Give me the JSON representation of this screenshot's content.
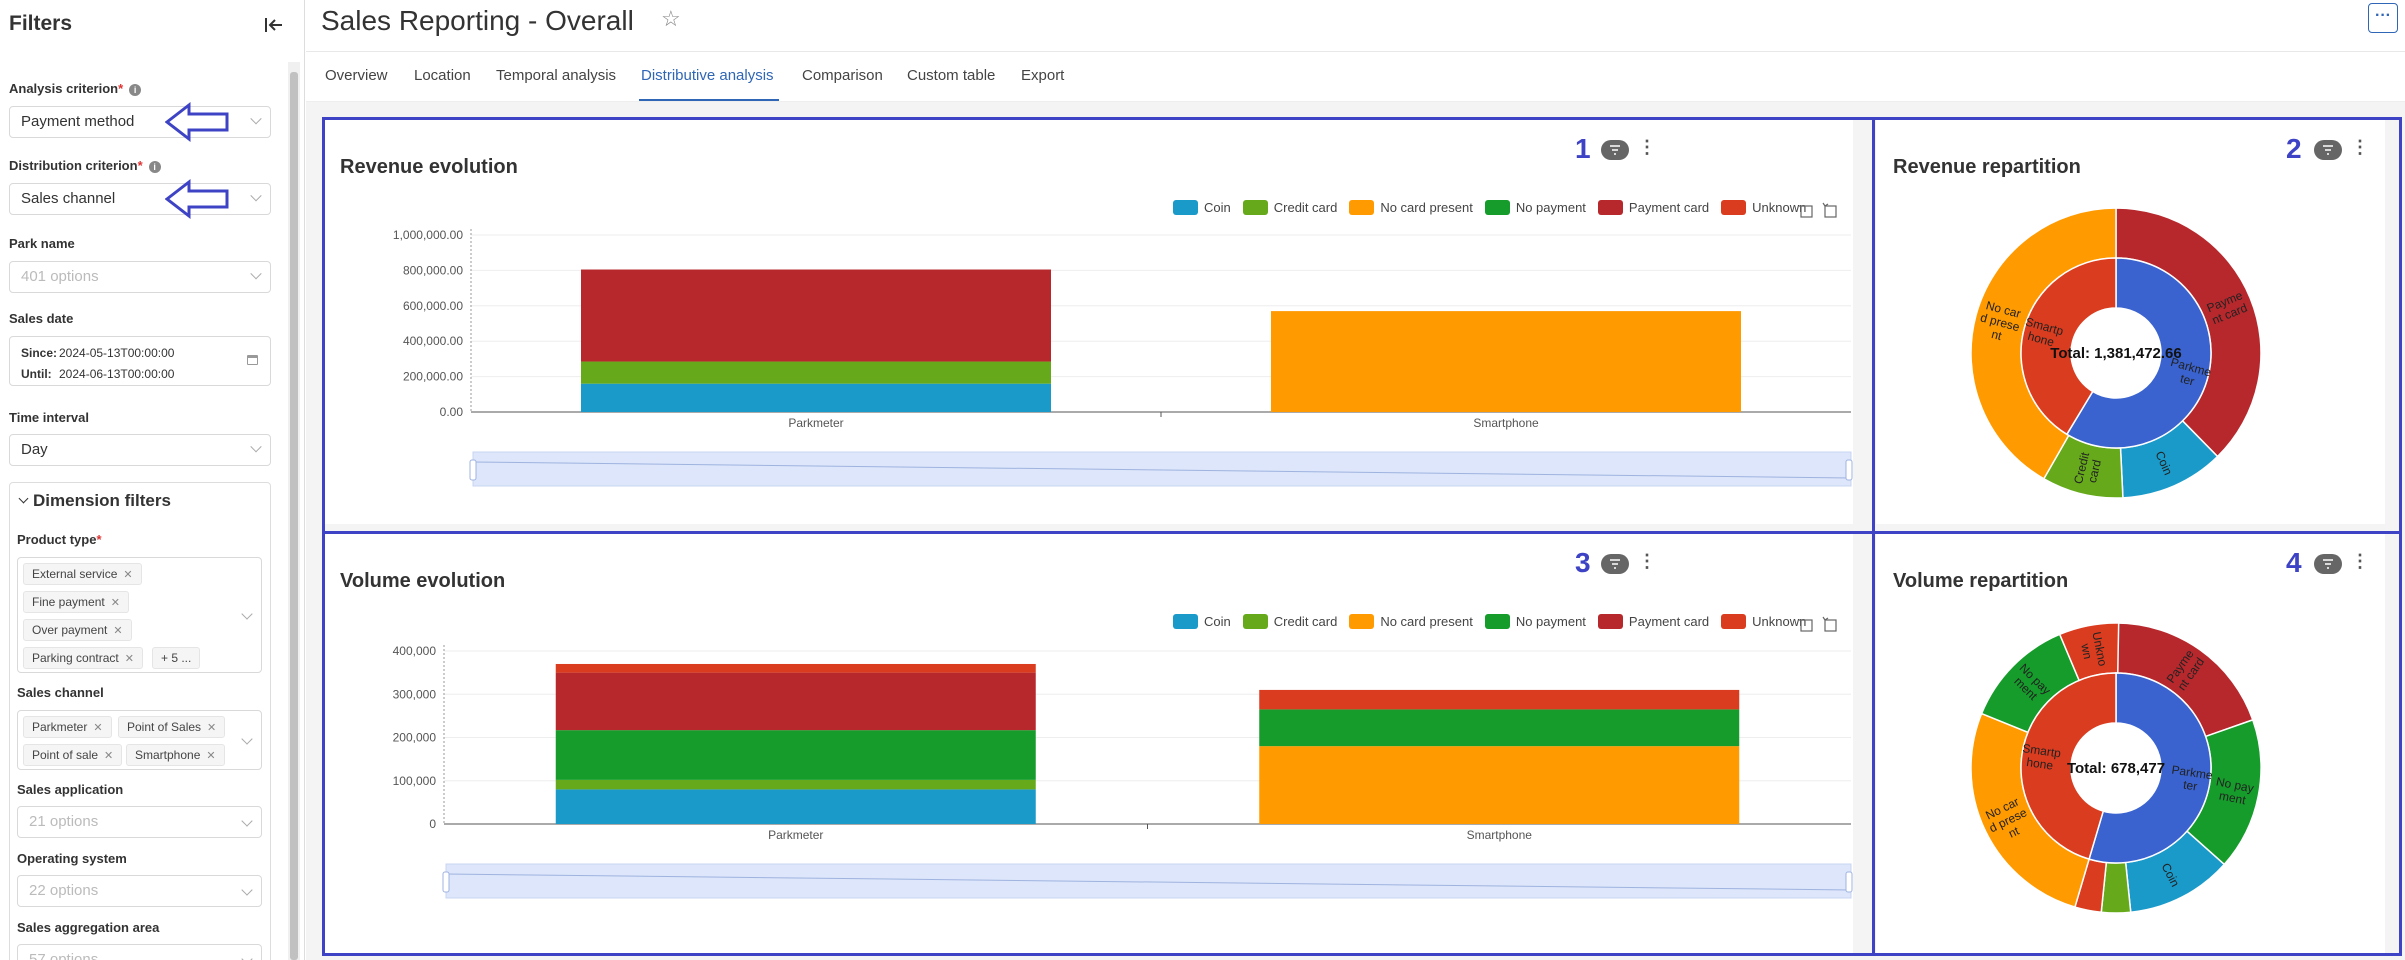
{
  "sidebar": {
    "title": "Filters",
    "analysis_criterion": {
      "label": "Analysis criterion",
      "required": "*",
      "value": "Payment method"
    },
    "distribution_criterion": {
      "label": "Distribution criterion",
      "required": "*",
      "value": "Sales channel"
    },
    "park_name": {
      "label": "Park name",
      "placeholder": "401 options"
    },
    "sales_date": {
      "label": "Sales date",
      "since_label": "Since:",
      "since": "2024-05-13T00:00:00",
      "until_label": "Until:",
      "until": "2024-06-13T00:00:00"
    },
    "time_interval": {
      "label": "Time interval",
      "value": "Day"
    },
    "dimension_filters": {
      "title": "Dimension filters",
      "product_type": {
        "label": "Product type",
        "required": "*",
        "tags": [
          "External service",
          "Fine payment",
          "Over payment",
          "Parking contract"
        ],
        "more": "+ 5 ..."
      },
      "sales_channel": {
        "label": "Sales channel",
        "tags": [
          "Parkmeter",
          "Point of Sales",
          "Point of sale",
          "Smartphone"
        ]
      },
      "sales_application": {
        "label": "Sales application",
        "placeholder": "21 options"
      },
      "operating_system": {
        "label": "Operating system",
        "placeholder": "22 options"
      },
      "sales_aggregation_area": {
        "label": "Sales aggregation area",
        "placeholder": "57 options"
      }
    }
  },
  "header": {
    "title": "Sales Reporting - Overall",
    "more": "···"
  },
  "tabs": [
    "Overview",
    "Location",
    "Temporal analysis",
    "Distributive analysis",
    "Comparison",
    "Custom table",
    "Export"
  ],
  "active_tab": "Distributive analysis",
  "colors": {
    "Coin": "#1a9ac9",
    "Credit card": "#66aa1c",
    "No card present": "#ff9a00",
    "No payment": "#169c2b",
    "Payment card": "#b7282d",
    "Unknown": "#da3c1f",
    "frame": "#3d43c4",
    "inner_parkmeter": "#3a63cf",
    "inner_smartphone": "#da3c1f"
  },
  "legend": [
    "Coin",
    "Credit card",
    "No card present",
    "No payment",
    "Payment card",
    "Unknown"
  ],
  "panels": {
    "p1": {
      "number": "1",
      "title": "Revenue evolution"
    },
    "p2": {
      "number": "2",
      "title": "Revenue repartition",
      "total": "Total: 1,381,472.66"
    },
    "p3": {
      "number": "3",
      "title": "Volume evolution"
    },
    "p4": {
      "number": "4",
      "title": "Volume repartition",
      "total": "Total: 678,477"
    }
  },
  "chart_data": [
    {
      "type": "bar",
      "stacked": true,
      "title": "Revenue evolution",
      "categories": [
        "Parkmeter",
        "Smartphone"
      ],
      "yticks": [
        "0.00",
        "200,000.00",
        "400,000.00",
        "600,000.00",
        "800,000.00",
        "1,000,000.00"
      ],
      "ylim": [
        0,
        1000000
      ],
      "series": [
        {
          "name": "Coin",
          "values": [
            160000,
            0
          ]
        },
        {
          "name": "Credit card",
          "values": [
            125000,
            0
          ]
        },
        {
          "name": "No card present",
          "values": [
            0,
            570000
          ]
        },
        {
          "name": "No payment",
          "values": [
            0,
            0
          ]
        },
        {
          "name": "Payment card",
          "values": [
            520000,
            0
          ]
        },
        {
          "name": "Unknown",
          "values": [
            0,
            0
          ]
        }
      ]
    },
    {
      "type": "pie",
      "title": "Revenue repartition",
      "total_label": "Total: 1,381,472.66",
      "inner": [
        {
          "name": "Parkmeter",
          "label": "Parkme\nter",
          "value": 810000
        },
        {
          "name": "Smartphone",
          "label": "Smartp\nhone",
          "value": 571000
        }
      ],
      "outer": [
        {
          "name": "Payment card",
          "label": "Payme\nnt card",
          "value": 520000
        },
        {
          "name": "Coin",
          "label": "Coin",
          "value": 160000
        },
        {
          "name": "Credit card",
          "label": "Credit\ncard",
          "value": 125000
        },
        {
          "name": "No card present",
          "label": "No car\nd prese\nnt",
          "value": 576000
        }
      ]
    },
    {
      "type": "bar",
      "stacked": true,
      "title": "Volume evolution",
      "categories": [
        "Parkmeter",
        "Smartphone"
      ],
      "yticks": [
        "0",
        "100,000",
        "200,000",
        "300,000",
        "400,000"
      ],
      "ylim": [
        0,
        400000
      ],
      "series": [
        {
          "name": "Coin",
          "values": [
            80000,
            0
          ]
        },
        {
          "name": "Credit card",
          "values": [
            22000,
            0
          ]
        },
        {
          "name": "No card present",
          "values": [
            0,
            180000
          ]
        },
        {
          "name": "No payment",
          "values": [
            115000,
            85000
          ]
        },
        {
          "name": "Payment card",
          "values": [
            133000,
            0
          ]
        },
        {
          "name": "Unknown",
          "values": [
            20000,
            45000
          ]
        }
      ]
    },
    {
      "type": "pie",
      "title": "Volume repartition",
      "total_label": "Total: 678,477",
      "inner": [
        {
          "name": "Parkmeter",
          "label": "Parkme\nter",
          "value": 370000
        },
        {
          "name": "Smartphone",
          "label": "Smartp\nhone",
          "value": 308000
        }
      ],
      "outer": [
        {
          "name": "Payment card",
          "label": "Payme\nnt card",
          "value": 133000
        },
        {
          "name": "No payment",
          "label": "No pay\nment",
          "value": 115000
        },
        {
          "name": "Coin",
          "label": "Coin",
          "value": 80000
        },
        {
          "name": "Credit card",
          "label": "",
          "value": 22000
        },
        {
          "name": "Unknown",
          "label": "",
          "value": 20000
        },
        {
          "name": "No card present",
          "label": "No car\nd prese\nnt",
          "value": 180000
        },
        {
          "name": "No payment",
          "label": "No pay\nment",
          "value": 85000
        },
        {
          "name": "Unknown",
          "label": "Unkno\nwn",
          "value": 45000
        }
      ]
    }
  ]
}
